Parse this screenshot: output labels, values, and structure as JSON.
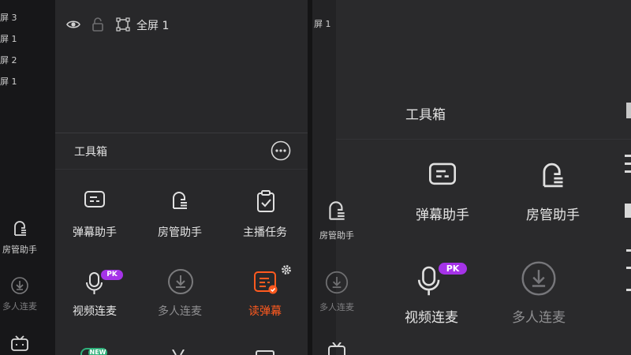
{
  "screen_list": {
    "items": [
      "屏 3",
      "屏 1",
      "屏 2",
      "屏 1"
    ]
  },
  "scene_bar": {
    "scene_name": "全屏 1",
    "icons": [
      "eye-icon",
      "lock-icon",
      "fullscreen-frame-icon"
    ]
  },
  "right_scene_list": {
    "items": [
      "屏 1"
    ]
  },
  "toolbox": {
    "title": "工具箱",
    "more_icon": "more-horizontal-icon",
    "tools": [
      {
        "label": "弹幕助手",
        "icon": "danmaku-assistant-icon",
        "state": "normal"
      },
      {
        "label": "房管助手",
        "icon": "room-admin-icon",
        "state": "normal"
      },
      {
        "label": "主播任务",
        "icon": "task-clipboard-icon",
        "state": "normal"
      },
      {
        "label": "视频连麦",
        "icon": "microphone-icon",
        "state": "normal",
        "badge": "PK"
      },
      {
        "label": "多人连麦",
        "icon": "multi-mic-download-icon",
        "state": "disabled"
      },
      {
        "label": "读弹幕",
        "icon": "read-danmaku-icon",
        "state": "active",
        "settings_icon": "gear-icon"
      }
    ],
    "partial_row_badge": "NEW"
  },
  "left_sidebar": {
    "items": [
      {
        "label": "房管助手",
        "icon": "room-admin-icon",
        "state": "normal"
      },
      {
        "label": "多人连麦",
        "icon": "multi-mic-download-icon",
        "state": "disabled"
      },
      {
        "label": "",
        "icon": "tv-icon",
        "state": "normal"
      }
    ]
  },
  "right_panel": {
    "title": "工具箱",
    "tools": [
      {
        "label": "弹幕助手",
        "icon": "danmaku-assistant-icon",
        "state": "normal"
      },
      {
        "label": "房管助手",
        "icon": "room-admin-icon",
        "state": "normal"
      },
      {
        "label": "视频连麦",
        "icon": "microphone-icon",
        "state": "normal",
        "badge": "PK"
      },
      {
        "label": "多人连麦",
        "icon": "multi-mic-download-icon",
        "state": "disabled"
      }
    ],
    "sidebar": [
      {
        "label": "房管助手",
        "icon": "room-admin-icon",
        "state": "normal"
      },
      {
        "label": "多人连麦",
        "icon": "multi-mic-download-icon",
        "state": "disabled"
      },
      {
        "label": "",
        "icon": "tv-icon",
        "state": "normal"
      }
    ]
  },
  "colors": {
    "accent": "#ff5a1f",
    "badge": "#a533e8",
    "text": "#e6e6e6",
    "muted": "#8e8e90"
  }
}
